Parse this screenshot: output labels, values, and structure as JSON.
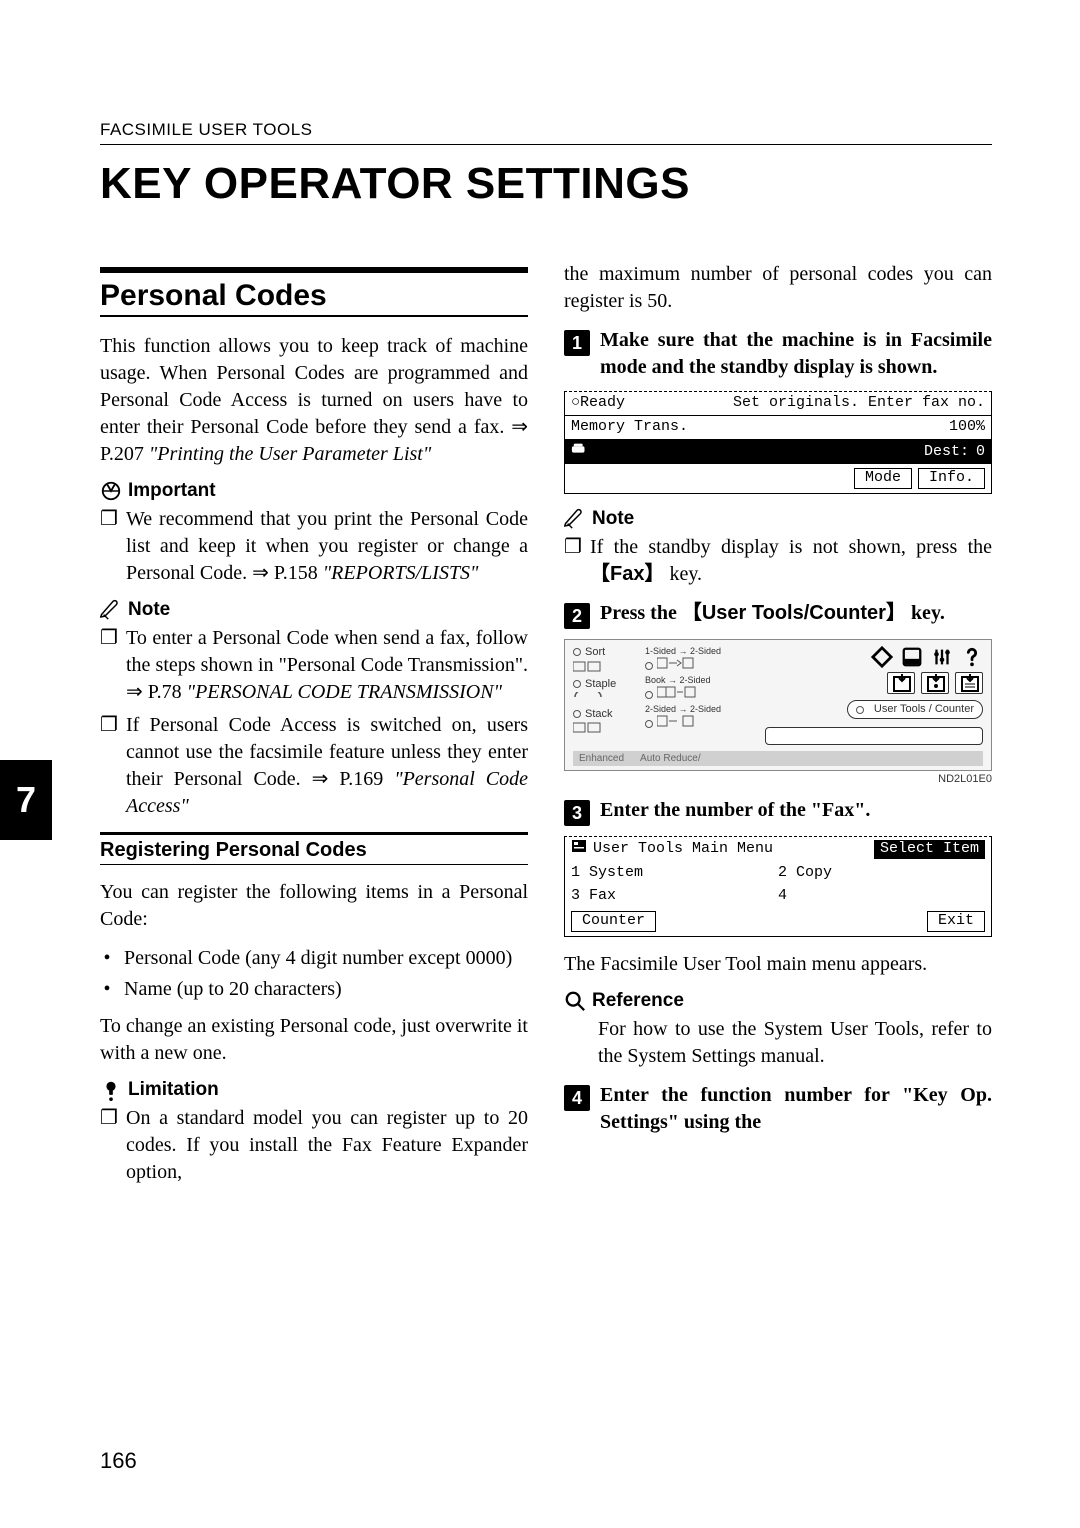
{
  "running_head": "FACSIMILE USER TOOLS",
  "page_title": "KEY OPERATOR SETTINGS",
  "side_tab": "7",
  "page_number": "166",
  "left": {
    "section_title": "Personal Codes",
    "intro": "This function allows you to keep track of machine usage. When Personal Codes are programmed and Personal Code Access is turned on users have to enter their Personal Code before they send a fax. ⇒ P.207 ",
    "intro_italic": "\"Printing the User Parameter List\"",
    "important_label": "Important",
    "important_item": "We recommend that you print the Personal Code list and keep it when you register or change a Personal Code. ⇒ P.158 ",
    "important_item_italic": "\"REPORTS/LISTS\"",
    "note_label": "Note",
    "note1": "To enter a Personal Code when send a fax, follow the steps shown in \"Personal Code Transmission\". ⇒ P.78 ",
    "note1_italic": "\"PERSONAL CODE TRANSMISSION\"",
    "note2": "If Personal Code Access is switched on, users cannot use the facsimile feature unless they enter their Personal Code. ⇒ P.169 ",
    "note2_italic": "\"Personal Code Access\"",
    "sub_title": "Registering Personal Codes",
    "sub_intro": "You can register the following items in a Personal Code:",
    "bullet1": "Personal Code (any 4 digit number except 0000)",
    "bullet2": "Name (up to 20 characters)",
    "sub_text2": "To change an existing Personal code, just overwrite it with a new one.",
    "limitation_label": "Limitation",
    "limitation_item": "On a standard model you can register up to 20 codes. If you install the Fax Feature Expander option,"
  },
  "right": {
    "cont_text": "the maximum number of personal codes you can register is 50.",
    "step1": "Make sure that the machine is in Facsimile mode and the standby display is shown.",
    "lcd1": {
      "r1a": "○Ready",
      "r1b": "Set originals. Enter fax no.",
      "r2a": "Memory Trans.",
      "r2b": "100%",
      "r3_dest_label": "Dest:",
      "r3_dest_val": "0",
      "r4_mode": "Mode",
      "r4_info": "Info."
    },
    "note_label": "Note",
    "note_item_a": "If the standby display is not shown, press the ",
    "note_key": "Fax",
    "note_item_b": " key.",
    "step2_a": "Press the ",
    "step2_key": "User Tools/Counter",
    "step2_b": " key.",
    "panel": {
      "c1_sort": "Sort",
      "c1_staple": "Staple",
      "c1_stack": "Stack",
      "c2_a": "1-Sided → 2-Sided",
      "c2_b": "Book → 2-Sided",
      "c2_c": "2-Sided → 2-Sided",
      "capsule": "User Tools / Counter",
      "bottom_a": "Enhanced",
      "bottom_b": "Auto Reduce/"
    },
    "fig_code": "ND2L01E0",
    "step3": "Enter the number of the \"Fax\".",
    "lcd2": {
      "r1a": "User Tools Main Menu",
      "r1b": "Select Item",
      "r2a": "1 System",
      "r2b": "2 Copy",
      "r3a": "3 Fax",
      "r3b": "4",
      "r4a": "Counter",
      "r4b": "Exit"
    },
    "post3": "The Facsimile User Tool main menu appears.",
    "ref_label": "Reference",
    "ref_text": "For how to use the System User Tools, refer to the System Settings manual.",
    "step4": "Enter the function number for \"Key Op. Settings\" using the"
  }
}
